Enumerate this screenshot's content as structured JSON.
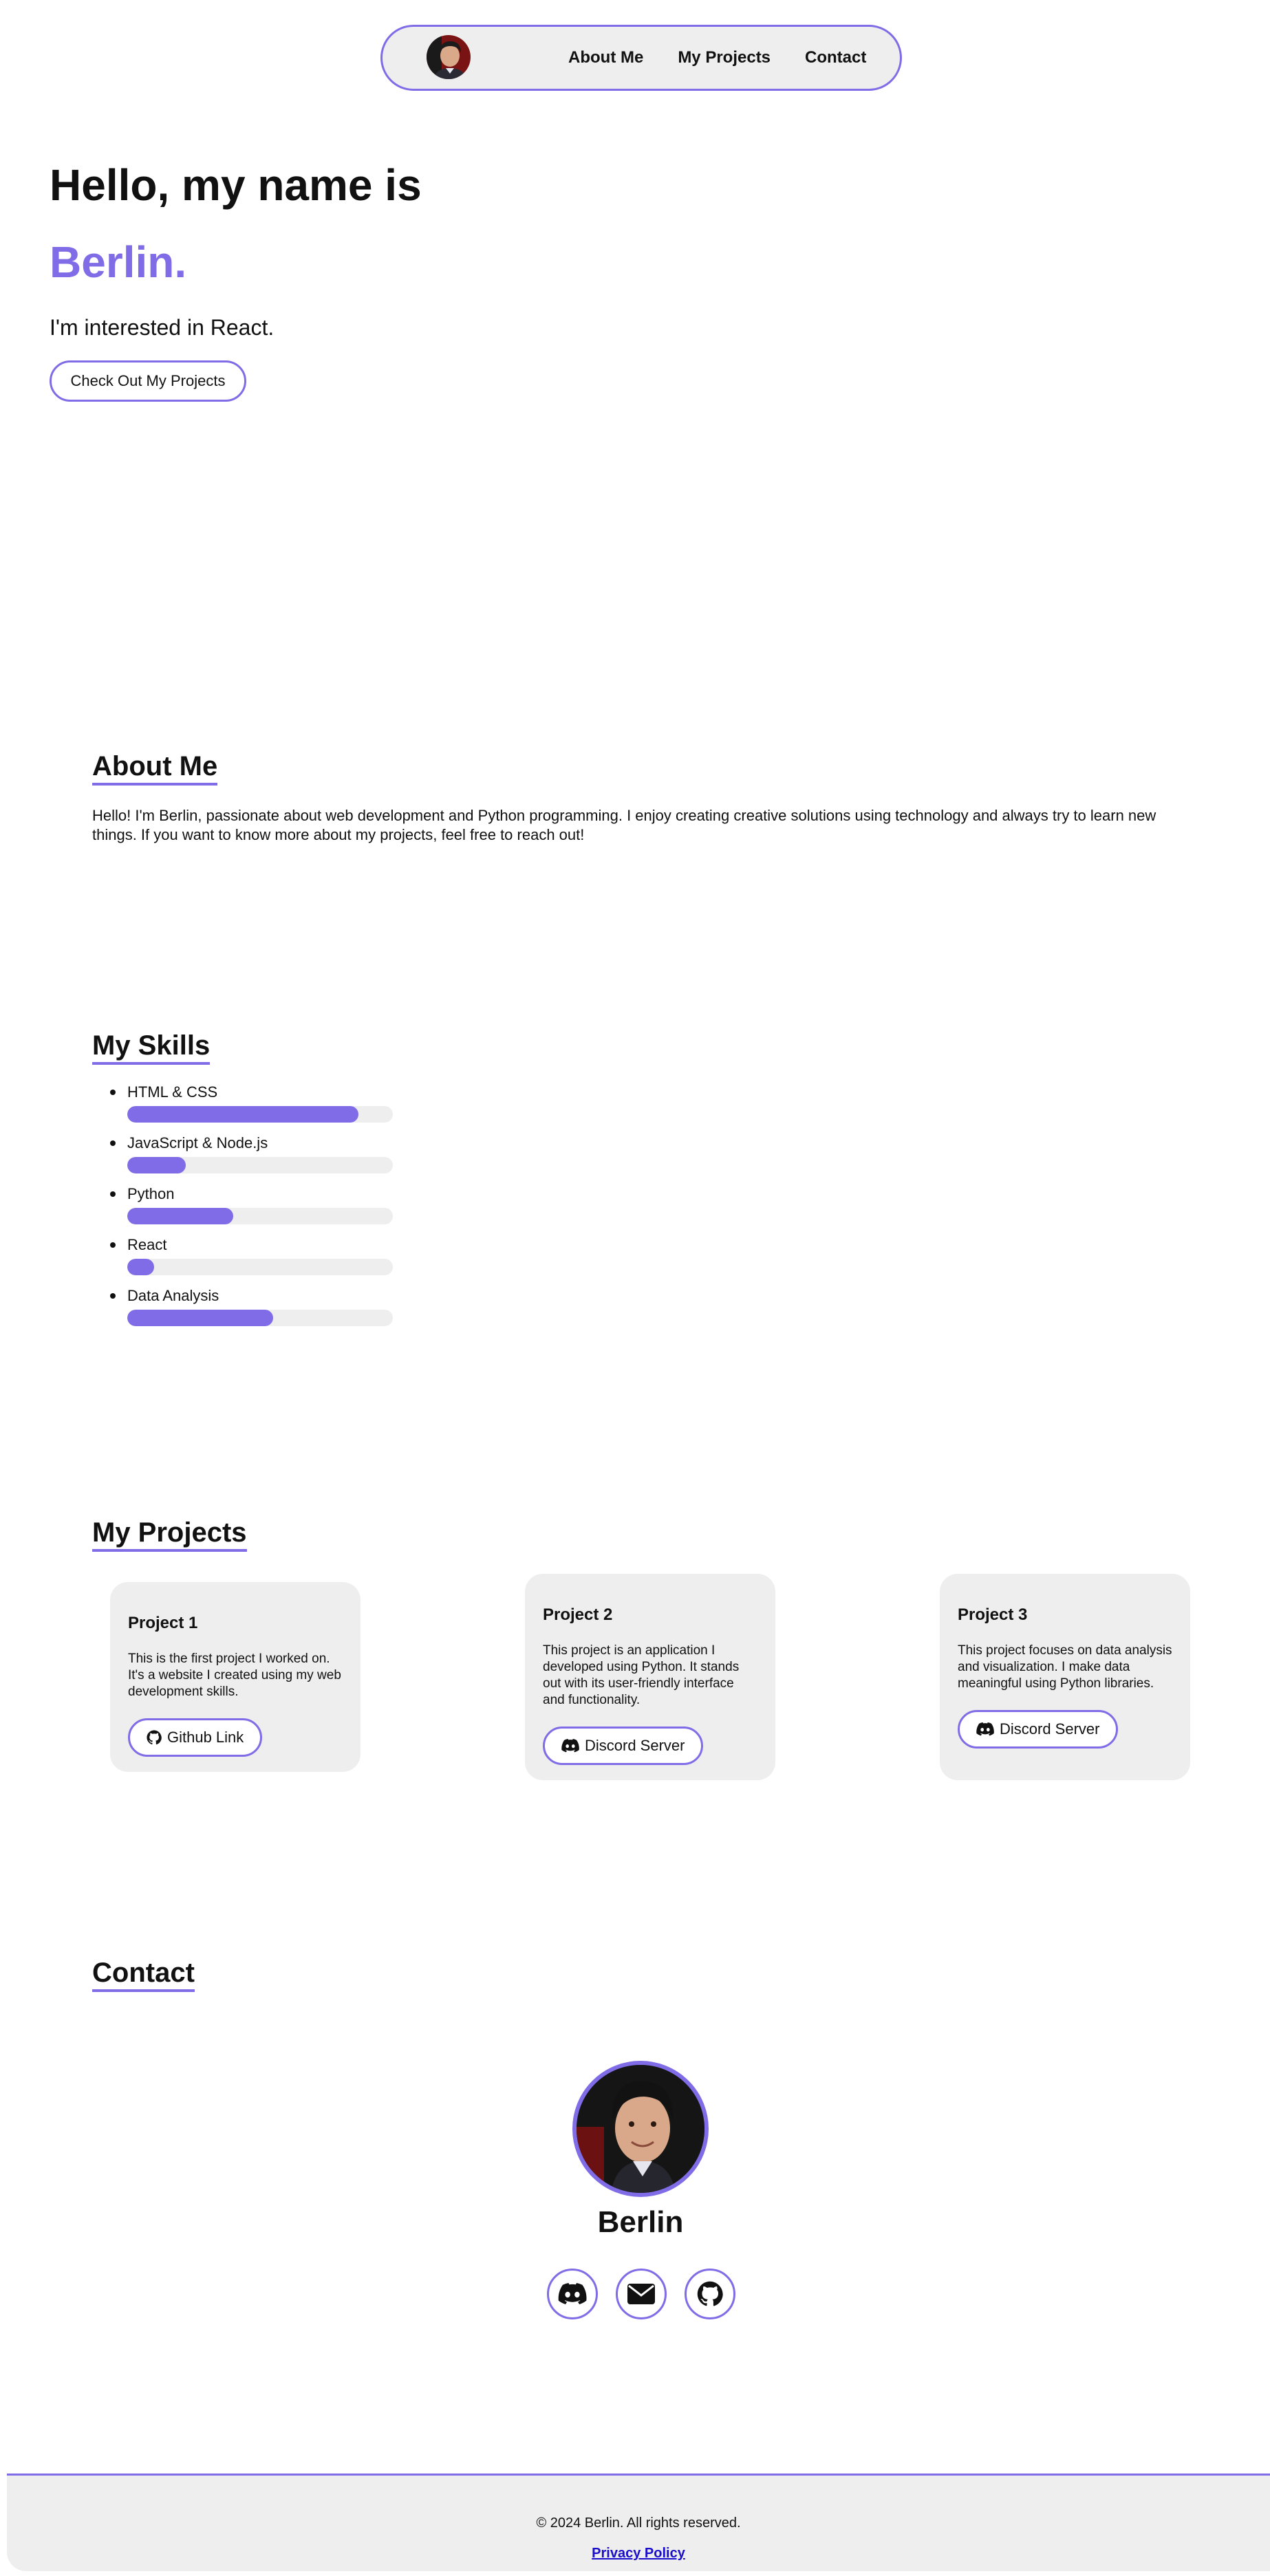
{
  "nav": {
    "links": [
      "About Me",
      "My Projects",
      "Contact"
    ]
  },
  "hero": {
    "greeting": "Hello, my name is",
    "name": "Berlin.",
    "interest": "I'm interested in React.",
    "cta_label": "Check Out My Projects"
  },
  "about": {
    "title": "About Me",
    "text": "Hello! I'm Berlin, passionate about web development and Python programming. I enjoy creating creative solutions using technology and always try to learn new things. If you want to know more about my projects, feel free to reach out!"
  },
  "skills": {
    "title": "My Skills",
    "items": [
      {
        "label": "HTML & CSS",
        "level": 0.87
      },
      {
        "label": "JavaScript & Node.js",
        "level": 0.22
      },
      {
        "label": "Python",
        "level": 0.4
      },
      {
        "label": "React",
        "level": 0.1
      },
      {
        "label": "Data Analysis",
        "level": 0.55
      }
    ]
  },
  "projects": {
    "title": "My Projects",
    "items": [
      {
        "title": "Project 1",
        "description": "This is the first project I worked on. It's a website I created using my web development skills.",
        "button": "Github Link",
        "icon": "github-icon"
      },
      {
        "title": "Project 2",
        "description": "This project is an application I developed using Python. It stands out with its user-friendly interface and functionality.",
        "button": "Discord Server",
        "icon": "discord-icon"
      },
      {
        "title": "Project 3",
        "description": "This project focuses on data analysis and visualization. I make data meaningful using Python libraries.",
        "button": "Discord Server",
        "icon": "discord-icon"
      }
    ]
  },
  "contact": {
    "title": "Contact",
    "name": "Berlin",
    "socials": [
      "discord-icon",
      "email-icon",
      "github-icon"
    ]
  },
  "footer": {
    "copyright": "© 2024 Berlin. All rights reserved.",
    "privacy": "Privacy Policy"
  },
  "colors": {
    "accent": "#7f6ce6",
    "panel": "#eeeeee",
    "link": "#1a0dcc"
  }
}
